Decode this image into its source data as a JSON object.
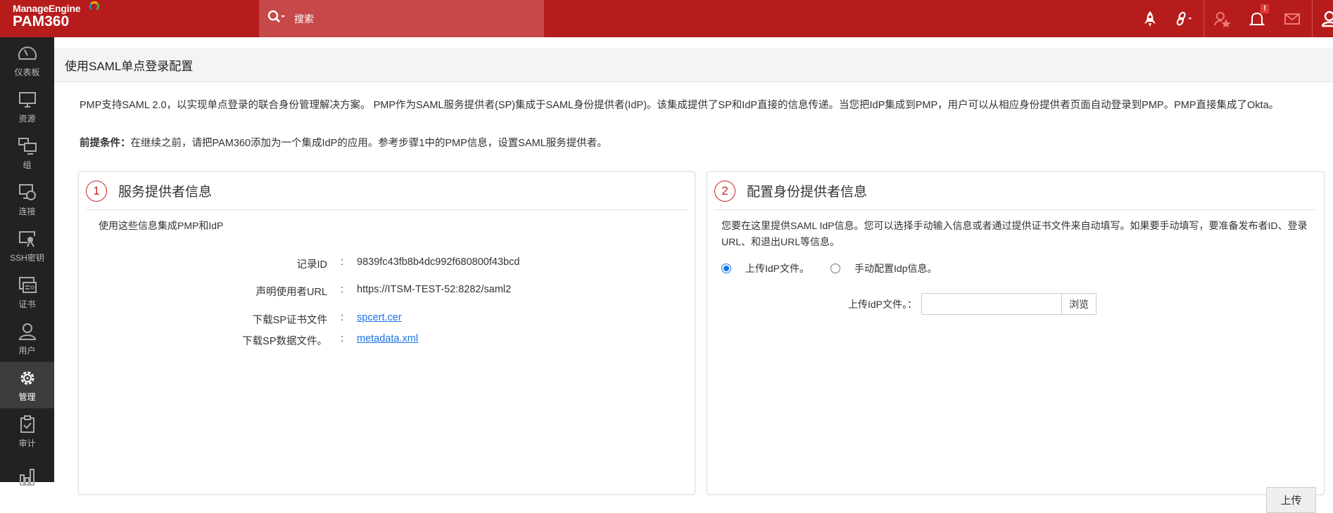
{
  "header": {
    "brand": "ManageEngine",
    "product": "PAM360",
    "search_label": "搜索",
    "notification_badge": "!"
  },
  "sidebar": {
    "items": [
      {
        "label": "仪表板",
        "icon": "dashboard-icon"
      },
      {
        "label": "资源",
        "icon": "monitor-icon"
      },
      {
        "label": "组",
        "icon": "group-icon"
      },
      {
        "label": "连接",
        "icon": "connection-icon"
      },
      {
        "label": "SSH密钥",
        "icon": "ssh-key-icon"
      },
      {
        "label": "证书",
        "icon": "certificate-icon"
      },
      {
        "label": "用户",
        "icon": "user-icon"
      },
      {
        "label": "管理",
        "icon": "gear-icon",
        "active": true
      },
      {
        "label": "审计",
        "icon": "audit-icon"
      },
      {
        "label": "",
        "icon": "reports-icon"
      }
    ]
  },
  "page": {
    "title": "使用SAML单点登录配置",
    "intro": "PMP支持SAML 2.0，以实现单点登录的联合身份管理解决方案。 PMP作为SAML服务提供者(SP)集成于SAML身份提供者(IdP)。该集成提供了SP和IdP直接的信息传递。当您把IdP集成到PMP，用户可以从相应身份提供者页面自动登录到PMP。PMP直接集成了Okta。",
    "prereq_label": "前提条件：",
    "prereq_text": "在继续之前，请把PAM360添加为一个集成IdP的应用。参考步骤1中的PMP信息，设置SAML服务提供者。"
  },
  "panel1": {
    "step": "1",
    "title": "服务提供者信息",
    "subtitle": "使用这些信息集成PMP和IdP",
    "colon": ":",
    "rows": [
      {
        "label": "记录ID",
        "value": "9839fc43fb8b4dc992f680800f43bcd"
      },
      {
        "label": "声明使用者URL",
        "value": "https://ITSM-TEST-52:8282/saml2"
      },
      {
        "label": "下载SP证书文件",
        "value": "spcert.cer"
      },
      {
        "label": "下载SP数据文件。",
        "value": "metadata.xml"
      }
    ]
  },
  "panel2": {
    "step": "2",
    "title": "配置身份提供者信息",
    "description": "您要在这里提供SAML IdP信息。您可以选择手动输入信息或者通过提供证书文件来自动填写。如果要手动填写，要准备发布者ID、登录URL、和退出URL等信息。",
    "radio_upload": "上传IdP文件。",
    "radio_manual": "手动配置Idp信息。",
    "upload_label": "上传IdP文件。：",
    "file_value": "",
    "browse": "浏览",
    "upload_button": "上传"
  },
  "colors": {
    "header": "#b71c1c",
    "sidebar": "#222222",
    "accent": "#c62828",
    "link": "#1a73e8"
  }
}
